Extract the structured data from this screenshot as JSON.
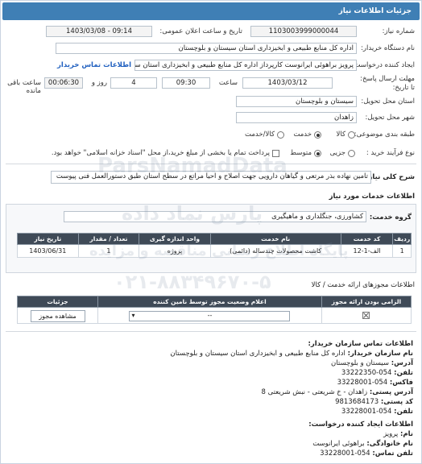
{
  "header": {
    "title": "جزئیات اطلاعات نیاز"
  },
  "need_number": {
    "label": "شماره نیاز:",
    "value": "1103003999000044"
  },
  "announce_datetime": {
    "label": "تاریخ و ساعت اعلان عمومی:",
    "value": "1403/03/08 - 09:14"
  },
  "buyer_org": {
    "label": "نام دستگاه خریدار:",
    "value": "اداره کل منابع طبیعی و ابخیزداری استان سیستان و بلوچستان"
  },
  "requester": {
    "label": "ایجاد کننده درخواست:",
    "value": "پرویز براهوئی ایرانوست کارپرداز اداره کل منابع طبیعی و ابخیزداری استان سیستان",
    "contact_link": "اطلاعات تماس خریدار"
  },
  "deadline": {
    "label": "مهلت ارسال پاسخ: تا تاریخ:",
    "date": "1403/03/12",
    "time_label": "ساعت",
    "time": "09:30",
    "days": "4",
    "days_label": "روز و",
    "remaining": "00:06:30",
    "remaining_label": "ساعت باقی مانده"
  },
  "delivery_province": {
    "label": "استان محل تحویل:",
    "value": "سیستان و بلوچستان"
  },
  "delivery_city": {
    "label": "شهر محل تحویل:",
    "value": "زاهدان"
  },
  "category": {
    "label": "طبقه بندی موضوعی:",
    "options": [
      "کالا",
      "خدمت",
      "کالا/خدمت"
    ],
    "selected": "خدمت"
  },
  "process": {
    "label": "نوع فرآیند خرید :",
    "options": [
      "جزیی",
      "متوسط"
    ],
    "selected": "متوسط",
    "note": "پرداخت تمام یا بخشی از مبلغ خرید،از محل \"اسناد خزانه اسلامی\" خواهد بود."
  },
  "summary": {
    "label": "شرح کلی نیاز:",
    "value": "تامین نهاده بذر مرتعی و گیاهان دارویی جهت اصلاح و احیا مراتع در سطح استان طبق دستورالعمل فنی پیوست"
  },
  "services_section": {
    "title": "اطلاعات خدمات مورد نیاز"
  },
  "service_group": {
    "label": "گروه خدمت:",
    "value": "کشاورزی، جنگلداری و ماهیگیری"
  },
  "services_table": {
    "headers": [
      "ردیف",
      "کد خدمت",
      "نام خدمت",
      "واحد اندازه گیری",
      "تعداد / مقدار",
      "تاریخ نیاز"
    ],
    "rows": [
      [
        "1",
        "الف-1-12",
        "کاشت محصولات چندساله (دائمی)",
        "پروژه",
        "1",
        "1403/06/31"
      ]
    ]
  },
  "permits_section": {
    "title": "اطلاعات مجوزهای ارائه خدمت / کالا"
  },
  "permits_table": {
    "headers": [
      "الزامی بودن ارائه مجوز",
      "اعلام وضعیت مجوز توسط نامین کننده",
      "جزئیات"
    ],
    "rows": [
      {
        "status": "--",
        "details_button": "مشاهده مجوز"
      }
    ]
  },
  "contact": {
    "title": "اطلاعات تماس سازمان خریدار:",
    "lines": [
      {
        "label": "نام سازمان خریدار:",
        "value": "اداره کل منابع طبیعی و ابخیزداری استان سیستان و بلوچستان"
      },
      {
        "label": "آدرس:",
        "value": "سیستان و بلوچستان"
      },
      {
        "label": "تلفن:",
        "value": "054-33222350"
      },
      {
        "label": "فاکس:",
        "value": "054-33228001"
      },
      {
        "label": "آدرس پستی:",
        "value": "زاهدان - خ شریعتی - نبش شریعتی 8"
      },
      {
        "label": "کد پستی:",
        "value": "9813684173"
      },
      {
        "label": "تلفن:",
        "value": "054-33228001"
      }
    ]
  },
  "creator": {
    "title": "اطلاعات ایجاد کننده درخواست:",
    "lines": [
      {
        "label": "نام:",
        "value": "پرویز"
      },
      {
        "label": "نام خانوادگی:",
        "value": "براهوئی ایرانوست"
      },
      {
        "label": "تلفن تماس:",
        "value": "054-33228001"
      }
    ]
  },
  "watermark": {
    "brand": "ParsNamadData",
    "line1": "پارس نماد داده",
    "line2": "پایگاه اطلاع رسانی مناقصه و مزایده",
    "phone": "۰۲۱-۸۸۳۴۹۶۷۰-۵"
  }
}
